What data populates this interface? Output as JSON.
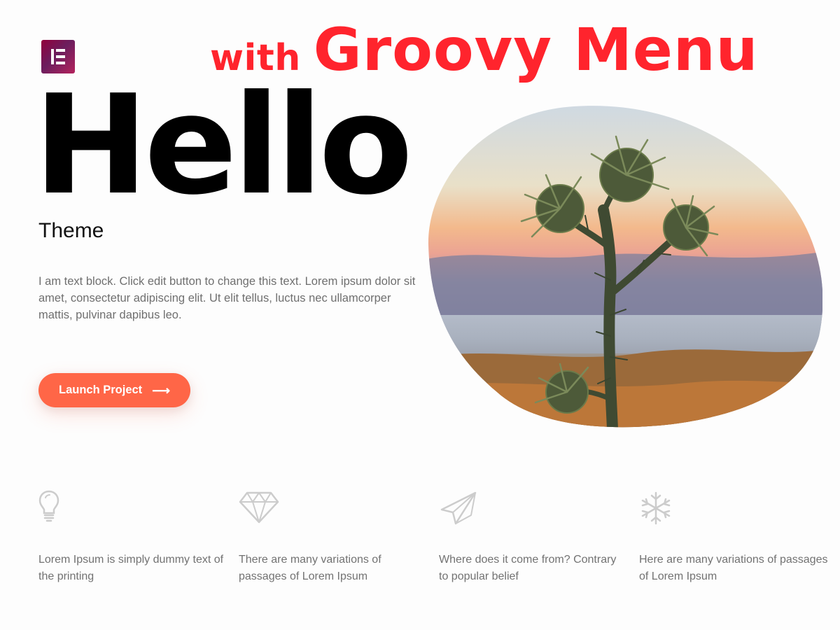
{
  "logo": {
    "icon": "elementor-logo-icon"
  },
  "headline": {
    "prefix": "with",
    "brand": "Groovy Menu"
  },
  "hero": {
    "title": "Hello",
    "subtitle": "Theme",
    "body": "I am text block. Click edit button to change this text. Lorem ipsum dolor sit amet, consectetur adipiscing elit. Ut elit tellus, luctus nec ullamcorper mattis, pulvinar dapibus leo.",
    "button_label": "Launch Project",
    "button_icon": "arrow-right-icon",
    "image": "thistle-sunset-photo"
  },
  "colors": {
    "headline": "#ff242d",
    "button": "#ff6647",
    "body_text": "#6f6f6f",
    "icon_gray": "#cccccc"
  },
  "features": [
    {
      "icon": "lightbulb-icon",
      "text": "Lorem Ipsum is simply dummy text of the printing"
    },
    {
      "icon": "diamond-icon",
      "text": "There are many variations of passages of Lorem Ipsum"
    },
    {
      "icon": "paper-plane-icon",
      "text": "Where does it come from? Contrary to popular belief"
    },
    {
      "icon": "snowflake-icon",
      "text": "Here are many variations of passages of Lorem Ipsum"
    }
  ]
}
